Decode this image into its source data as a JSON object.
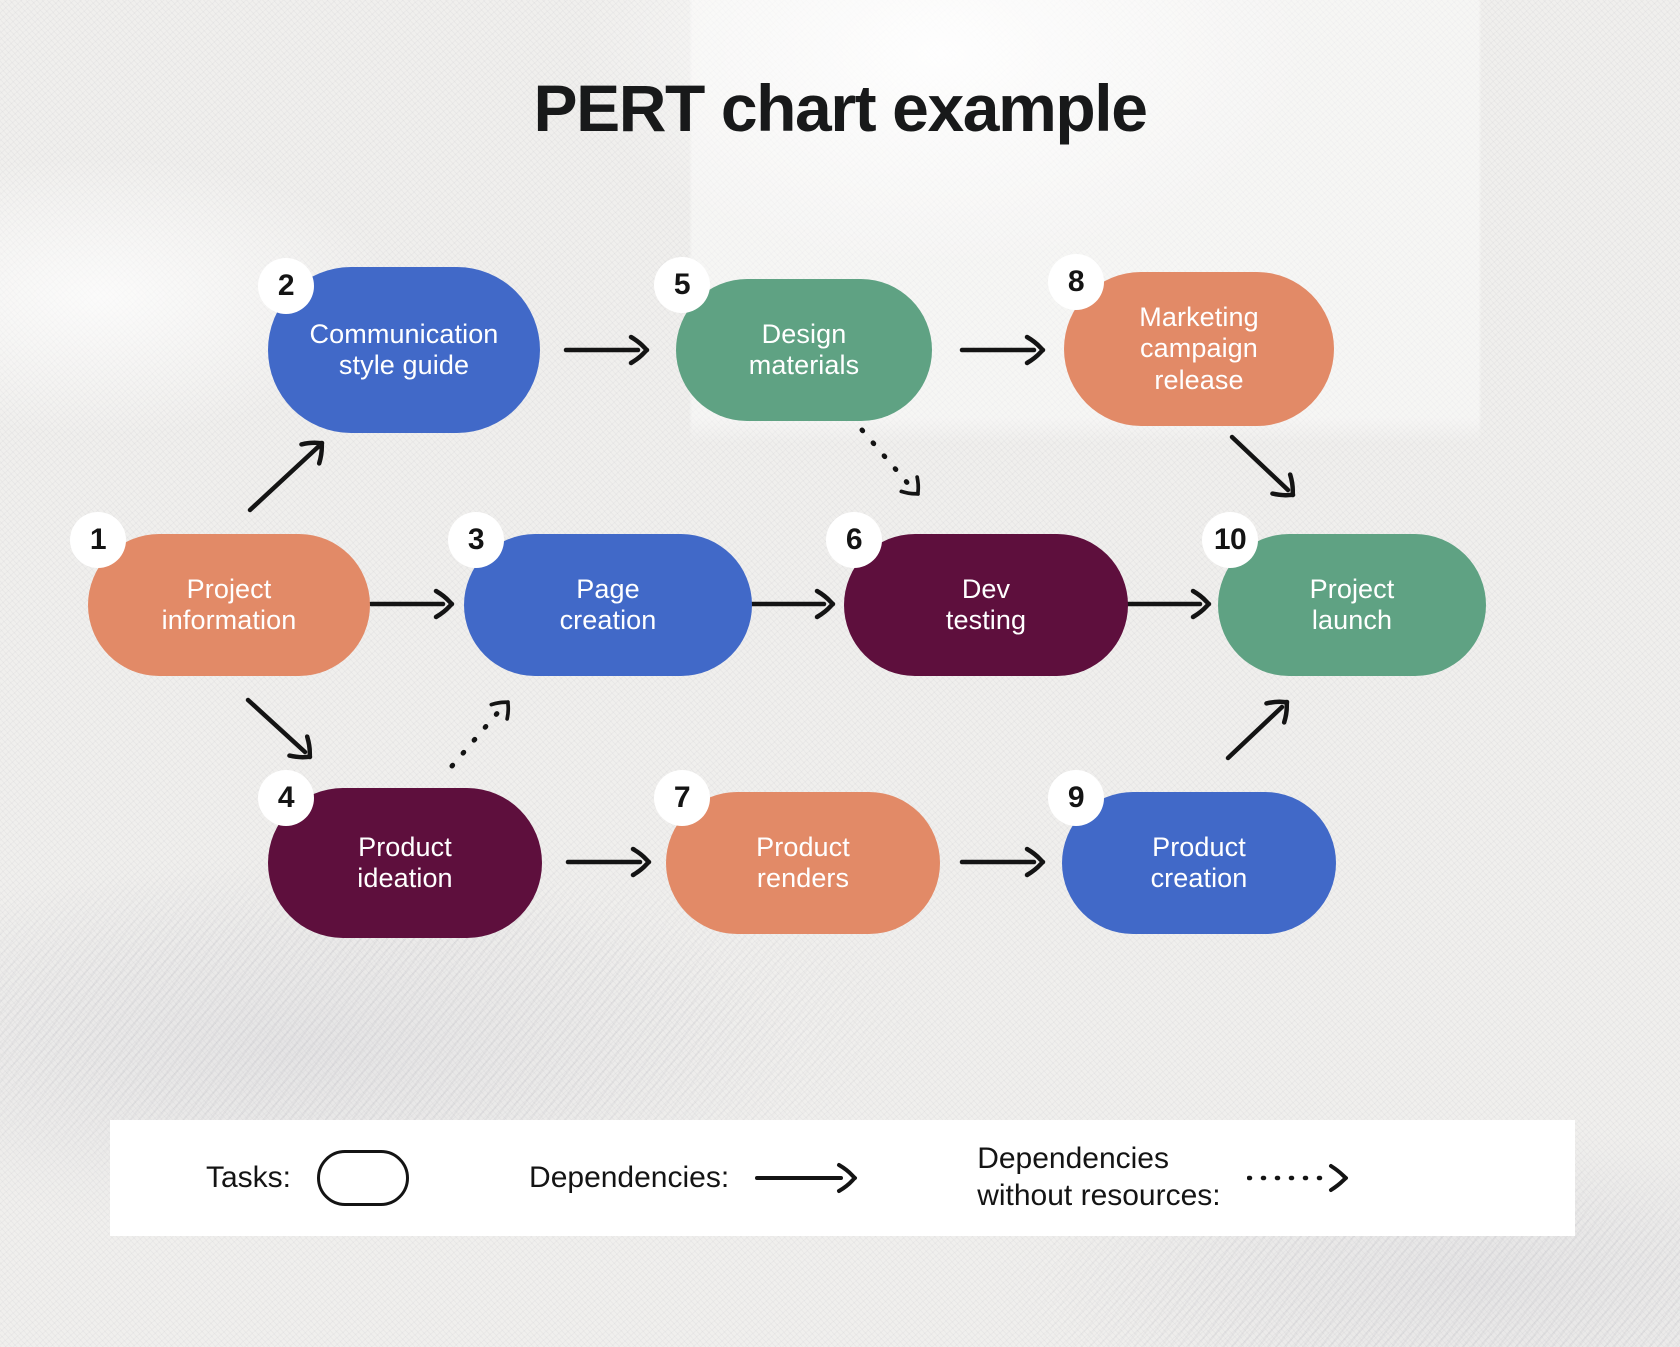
{
  "title": "PERT chart example",
  "theme": {
    "background": "#f0efed",
    "blue": "#4169c8",
    "green": "#5fa283",
    "orange": "#e28a67",
    "maroon": "#5e0f3d",
    "badge_bg": "#ffffff",
    "badge_text": "#141414",
    "line": "#141414",
    "legend_bg": "#ffffff"
  },
  "chart_data": {
    "type": "diagram",
    "subtype": "pert-chart",
    "title": "PERT chart example",
    "nodes": [
      {
        "id": 1,
        "number": "1",
        "label": "Project\ninformation",
        "color": "#e28a67",
        "color_name": "orange",
        "row": "middle",
        "col": 1
      },
      {
        "id": 2,
        "number": "2",
        "label": "Communication\nstyle guide",
        "color": "#4169c8",
        "color_name": "blue",
        "row": "top",
        "col": 1
      },
      {
        "id": 3,
        "number": "3",
        "label": "Page\ncreation",
        "color": "#4169c8",
        "color_name": "blue",
        "row": "middle",
        "col": 2
      },
      {
        "id": 4,
        "number": "4",
        "label": "Product\nideation",
        "color": "#5e0f3d",
        "color_name": "maroon",
        "row": "bottom",
        "col": 1
      },
      {
        "id": 5,
        "number": "5",
        "label": "Design\nmaterials",
        "color": "#5fa283",
        "color_name": "green",
        "row": "top",
        "col": 2
      },
      {
        "id": 6,
        "number": "6",
        "label": "Dev\ntesting",
        "color": "#5e0f3d",
        "color_name": "maroon",
        "row": "middle",
        "col": 3
      },
      {
        "id": 7,
        "number": "7",
        "label": "Product\nrenders",
        "color": "#e28a67",
        "color_name": "orange",
        "row": "bottom",
        "col": 2
      },
      {
        "id": 8,
        "number": "8",
        "label": "Marketing\ncampaign\nrelease",
        "color": "#e28a67",
        "color_name": "orange",
        "row": "top",
        "col": 3
      },
      {
        "id": 9,
        "number": "9",
        "label": "Product\ncreation",
        "color": "#4169c8",
        "color_name": "blue",
        "row": "bottom",
        "col": 3
      },
      {
        "id": 10,
        "number": "10",
        "label": "Project\nlaunch",
        "color": "#5fa283",
        "color_name": "green",
        "row": "middle",
        "col": 4
      }
    ],
    "edges": [
      {
        "from": 1,
        "to": 2,
        "style": "solid",
        "direction": "up-right"
      },
      {
        "from": 1,
        "to": 3,
        "style": "solid",
        "direction": "right"
      },
      {
        "from": 1,
        "to": 4,
        "style": "solid",
        "direction": "down-right"
      },
      {
        "from": 2,
        "to": 5,
        "style": "solid",
        "direction": "right"
      },
      {
        "from": 5,
        "to": 8,
        "style": "solid",
        "direction": "right"
      },
      {
        "from": 5,
        "to": 6,
        "style": "dotted",
        "direction": "down-right"
      },
      {
        "from": 3,
        "to": 6,
        "style": "solid",
        "direction": "right"
      },
      {
        "from": 4,
        "to": 3,
        "style": "dotted",
        "direction": "up-right"
      },
      {
        "from": 4,
        "to": 7,
        "style": "solid",
        "direction": "right"
      },
      {
        "from": 7,
        "to": 9,
        "style": "solid",
        "direction": "right"
      },
      {
        "from": 6,
        "to": 10,
        "style": "solid",
        "direction": "right"
      },
      {
        "from": 8,
        "to": 10,
        "style": "solid",
        "direction": "down-right"
      },
      {
        "from": 9,
        "to": 10,
        "style": "solid",
        "direction": "up-right"
      }
    ]
  },
  "legend": {
    "tasks_label": "Tasks:",
    "dependencies_label": "Dependencies:",
    "dependencies_no_resources_label": "Dependencies\nwithout resources:"
  }
}
